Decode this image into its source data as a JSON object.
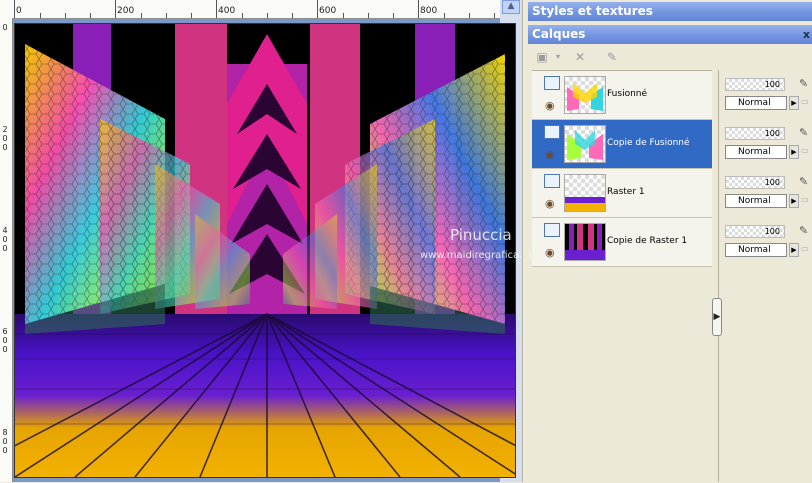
{
  "canvas": {
    "ruler_top_labels": [
      "0",
      "200",
      "400",
      "600",
      "800"
    ],
    "ruler_left_labels": [
      "0",
      "2",
      "0",
      "0",
      "4",
      "0",
      "0",
      "6",
      "0",
      "0",
      "8",
      "0",
      "0"
    ],
    "watermark_title": "Pinuccia",
    "watermark_url": "www.maidiregrafica.eu"
  },
  "panels": {
    "styles_title": "Styles et textures",
    "layers_title": "Calques"
  },
  "layers": [
    {
      "name": "Fusionné",
      "opacity": "100",
      "blend": "Normal",
      "selected": false
    },
    {
      "name": "Copie de Fusionné",
      "opacity": "100",
      "blend": "Normal",
      "selected": true
    },
    {
      "name": "Raster 1",
      "opacity": "100",
      "blend": "Normal",
      "selected": false
    },
    {
      "name": "Copie de Raster 1",
      "opacity": "100",
      "blend": "Normal",
      "selected": false
    }
  ],
  "icons": {
    "scroll_up": "scroll-up-icon",
    "eye": "eye-icon",
    "pen": "pen-icon",
    "grip": "splitter-grip-icon"
  }
}
